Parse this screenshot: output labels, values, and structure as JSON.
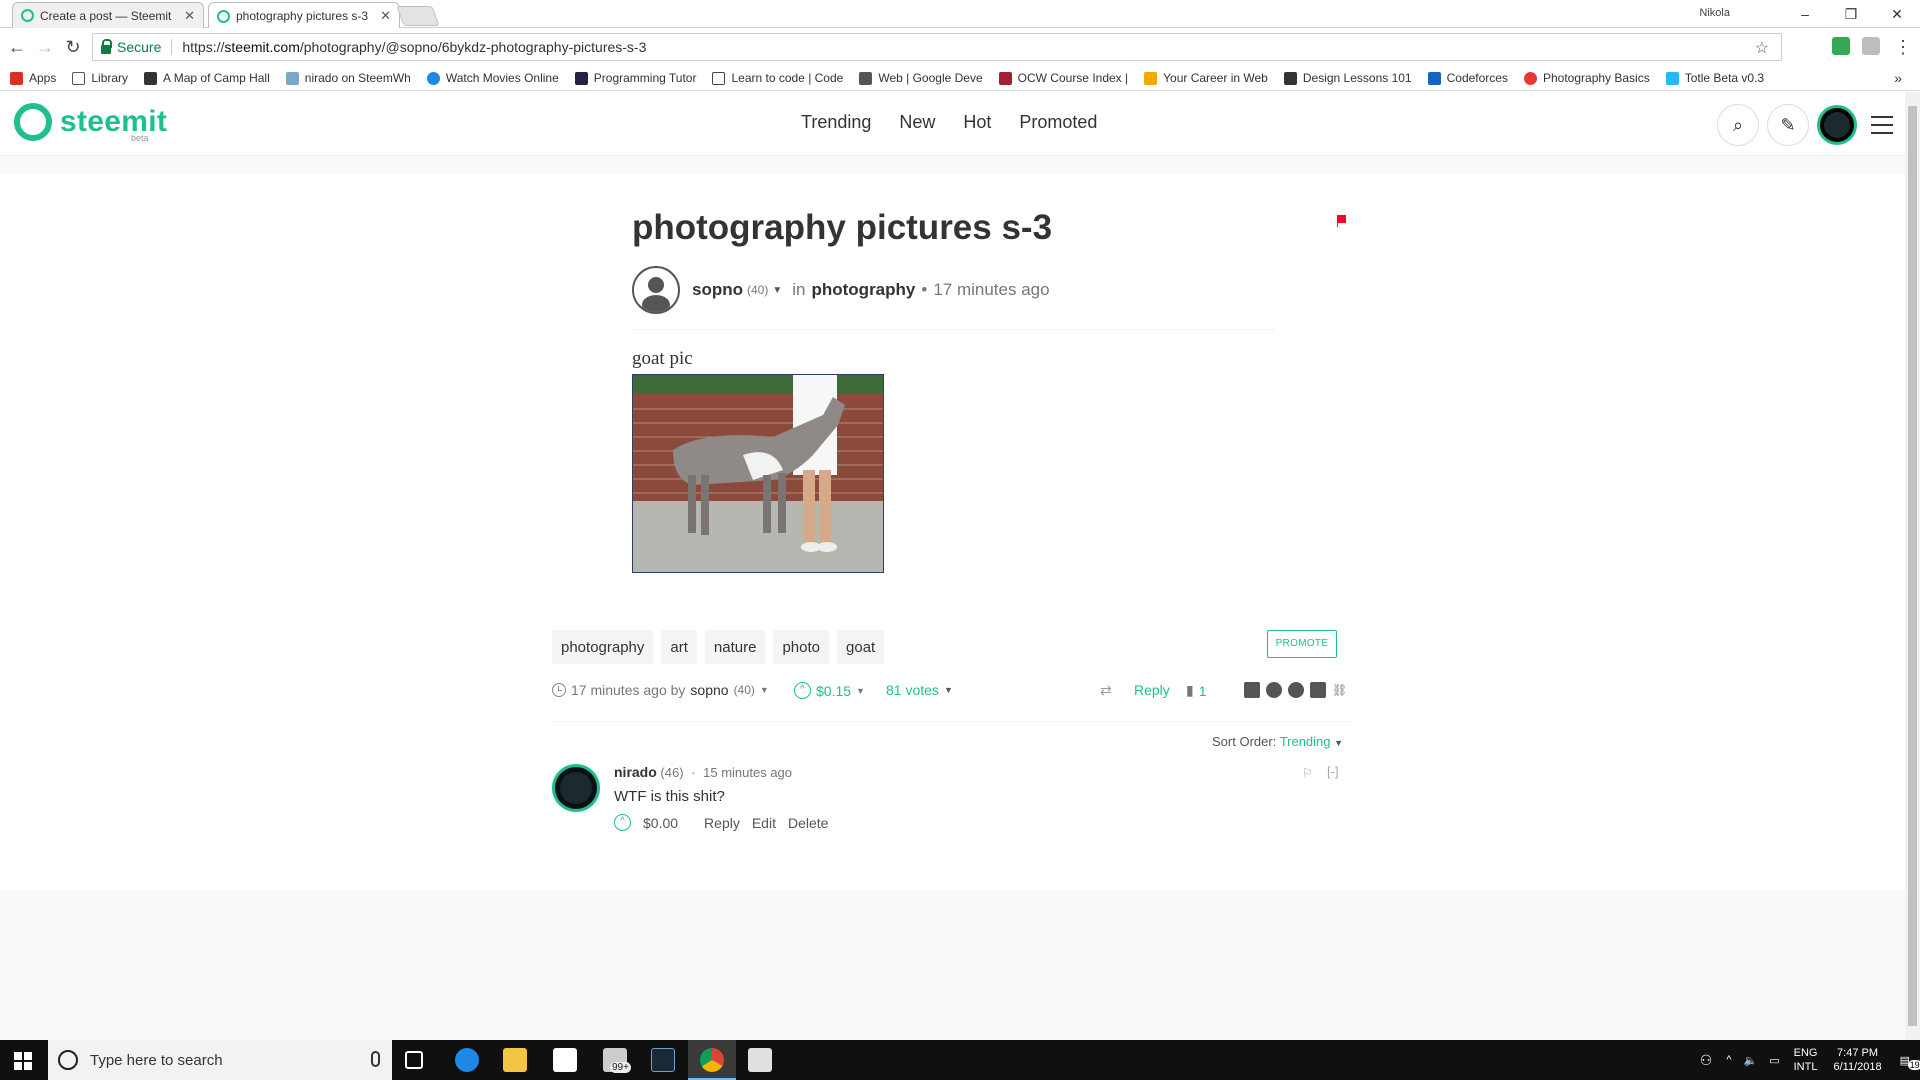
{
  "browser": {
    "tabs": [
      {
        "title": "Create a post — Steemit",
        "close": "✕"
      },
      {
        "title": "photography pictures s-3",
        "close": "✕"
      }
    ],
    "profile_name": "Nikola",
    "security_label": "Secure",
    "url_prefix": "https://",
    "url_host": "steemit.com",
    "url_path": "/photography/@sopno/6bykdz-photography-pictures-s-3",
    "bookmarks": [
      {
        "label": "Apps",
        "color": "#d93025"
      },
      {
        "label": "Library",
        "color": "#ffffff"
      },
      {
        "label": "A Map of Camp Hall",
        "color": "#333333"
      },
      {
        "label": "nirado on SteemWh",
        "color": "#7aa7c7"
      },
      {
        "label": "Watch Movies Online",
        "color": "#1e88e5"
      },
      {
        "label": "Programming Tutor",
        "color": "#222244"
      },
      {
        "label": "Learn to code | Code",
        "color": "#444444"
      },
      {
        "label": "Web | Google Deve",
        "color": "#555555"
      },
      {
        "label": "OCW Course Index |",
        "color": "#a31f34"
      },
      {
        "label": "Your Career in Web",
        "color": "#f2a900"
      },
      {
        "label": "Design Lessons 101",
        "color": "#333333"
      },
      {
        "label": "Codeforces",
        "color": "#1565c0"
      },
      {
        "label": "Photography Basics",
        "color": "#e53935"
      },
      {
        "label": "Totle Beta v0.3",
        "color": "#29b6f6"
      }
    ],
    "bookmarks_more": "»"
  },
  "site": {
    "logo": "steemit",
    "beta": "beta",
    "nav": [
      "Trending",
      "New",
      "Hot",
      "Promoted"
    ],
    "brand_color": "#1fbf8f"
  },
  "post": {
    "title": "photography pictures s-3",
    "author": "sopno",
    "author_rep": "(40)",
    "in_label": "in",
    "category": "photography",
    "bullet": "•",
    "time": "17 minutes ago",
    "body_text": "goat pic",
    "tags": [
      "photography",
      "art",
      "nature",
      "photo",
      "goat"
    ],
    "promote": "PROMOTE",
    "footer": {
      "time": "17 minutes ago by",
      "author": "sopno",
      "rep": "(40)",
      "payout": "$0.15",
      "votes": "81 votes",
      "reply": "Reply",
      "comment_count": "1"
    },
    "sort_label": "Sort Order:",
    "sort_value": "Trending"
  },
  "comment": {
    "author": "nirado",
    "rep": "(46)",
    "bullet": "·",
    "time": "15 minutes ago",
    "body": "WTF is this shit?",
    "payout": "$0.00",
    "actions": [
      "Reply",
      "Edit",
      "Delete"
    ],
    "collapse": "[-]"
  },
  "taskbar": {
    "search_placeholder": "Type here to search",
    "lang_top": "ENG",
    "lang_bottom": "INTL",
    "time": "7:47 PM",
    "date": "6/11/2018",
    "notification_count": "19",
    "mail_badge": "99+"
  }
}
